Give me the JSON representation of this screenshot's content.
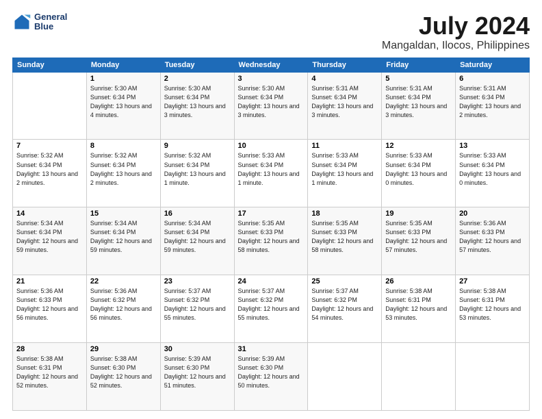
{
  "logo": {
    "line1": "General",
    "line2": "Blue"
  },
  "title": "July 2024",
  "subtitle": "Mangaldan, Ilocos, Philippines",
  "headers": [
    "Sunday",
    "Monday",
    "Tuesday",
    "Wednesday",
    "Thursday",
    "Friday",
    "Saturday"
  ],
  "weeks": [
    [
      {
        "day": "",
        "sunrise": "",
        "sunset": "",
        "daylight": ""
      },
      {
        "day": "1",
        "sunrise": "Sunrise: 5:30 AM",
        "sunset": "Sunset: 6:34 PM",
        "daylight": "Daylight: 13 hours and 4 minutes."
      },
      {
        "day": "2",
        "sunrise": "Sunrise: 5:30 AM",
        "sunset": "Sunset: 6:34 PM",
        "daylight": "Daylight: 13 hours and 3 minutes."
      },
      {
        "day": "3",
        "sunrise": "Sunrise: 5:30 AM",
        "sunset": "Sunset: 6:34 PM",
        "daylight": "Daylight: 13 hours and 3 minutes."
      },
      {
        "day": "4",
        "sunrise": "Sunrise: 5:31 AM",
        "sunset": "Sunset: 6:34 PM",
        "daylight": "Daylight: 13 hours and 3 minutes."
      },
      {
        "day": "5",
        "sunrise": "Sunrise: 5:31 AM",
        "sunset": "Sunset: 6:34 PM",
        "daylight": "Daylight: 13 hours and 3 minutes."
      },
      {
        "day": "6",
        "sunrise": "Sunrise: 5:31 AM",
        "sunset": "Sunset: 6:34 PM",
        "daylight": "Daylight: 13 hours and 2 minutes."
      }
    ],
    [
      {
        "day": "7",
        "sunrise": "Sunrise: 5:32 AM",
        "sunset": "Sunset: 6:34 PM",
        "daylight": "Daylight: 13 hours and 2 minutes."
      },
      {
        "day": "8",
        "sunrise": "Sunrise: 5:32 AM",
        "sunset": "Sunset: 6:34 PM",
        "daylight": "Daylight: 13 hours and 2 minutes."
      },
      {
        "day": "9",
        "sunrise": "Sunrise: 5:32 AM",
        "sunset": "Sunset: 6:34 PM",
        "daylight": "Daylight: 13 hours and 1 minute."
      },
      {
        "day": "10",
        "sunrise": "Sunrise: 5:33 AM",
        "sunset": "Sunset: 6:34 PM",
        "daylight": "Daylight: 13 hours and 1 minute."
      },
      {
        "day": "11",
        "sunrise": "Sunrise: 5:33 AM",
        "sunset": "Sunset: 6:34 PM",
        "daylight": "Daylight: 13 hours and 1 minute."
      },
      {
        "day": "12",
        "sunrise": "Sunrise: 5:33 AM",
        "sunset": "Sunset: 6:34 PM",
        "daylight": "Daylight: 13 hours and 0 minutes."
      },
      {
        "day": "13",
        "sunrise": "Sunrise: 5:33 AM",
        "sunset": "Sunset: 6:34 PM",
        "daylight": "Daylight: 13 hours and 0 minutes."
      }
    ],
    [
      {
        "day": "14",
        "sunrise": "Sunrise: 5:34 AM",
        "sunset": "Sunset: 6:34 PM",
        "daylight": "Daylight: 12 hours and 59 minutes."
      },
      {
        "day": "15",
        "sunrise": "Sunrise: 5:34 AM",
        "sunset": "Sunset: 6:34 PM",
        "daylight": "Daylight: 12 hours and 59 minutes."
      },
      {
        "day": "16",
        "sunrise": "Sunrise: 5:34 AM",
        "sunset": "Sunset: 6:34 PM",
        "daylight": "Daylight: 12 hours and 59 minutes."
      },
      {
        "day": "17",
        "sunrise": "Sunrise: 5:35 AM",
        "sunset": "Sunset: 6:33 PM",
        "daylight": "Daylight: 12 hours and 58 minutes."
      },
      {
        "day": "18",
        "sunrise": "Sunrise: 5:35 AM",
        "sunset": "Sunset: 6:33 PM",
        "daylight": "Daylight: 12 hours and 58 minutes."
      },
      {
        "day": "19",
        "sunrise": "Sunrise: 5:35 AM",
        "sunset": "Sunset: 6:33 PM",
        "daylight": "Daylight: 12 hours and 57 minutes."
      },
      {
        "day": "20",
        "sunrise": "Sunrise: 5:36 AM",
        "sunset": "Sunset: 6:33 PM",
        "daylight": "Daylight: 12 hours and 57 minutes."
      }
    ],
    [
      {
        "day": "21",
        "sunrise": "Sunrise: 5:36 AM",
        "sunset": "Sunset: 6:33 PM",
        "daylight": "Daylight: 12 hours and 56 minutes."
      },
      {
        "day": "22",
        "sunrise": "Sunrise: 5:36 AM",
        "sunset": "Sunset: 6:32 PM",
        "daylight": "Daylight: 12 hours and 56 minutes."
      },
      {
        "day": "23",
        "sunrise": "Sunrise: 5:37 AM",
        "sunset": "Sunset: 6:32 PM",
        "daylight": "Daylight: 12 hours and 55 minutes."
      },
      {
        "day": "24",
        "sunrise": "Sunrise: 5:37 AM",
        "sunset": "Sunset: 6:32 PM",
        "daylight": "Daylight: 12 hours and 55 minutes."
      },
      {
        "day": "25",
        "sunrise": "Sunrise: 5:37 AM",
        "sunset": "Sunset: 6:32 PM",
        "daylight": "Daylight: 12 hours and 54 minutes."
      },
      {
        "day": "26",
        "sunrise": "Sunrise: 5:38 AM",
        "sunset": "Sunset: 6:31 PM",
        "daylight": "Daylight: 12 hours and 53 minutes."
      },
      {
        "day": "27",
        "sunrise": "Sunrise: 5:38 AM",
        "sunset": "Sunset: 6:31 PM",
        "daylight": "Daylight: 12 hours and 53 minutes."
      }
    ],
    [
      {
        "day": "28",
        "sunrise": "Sunrise: 5:38 AM",
        "sunset": "Sunset: 6:31 PM",
        "daylight": "Daylight: 12 hours and 52 minutes."
      },
      {
        "day": "29",
        "sunrise": "Sunrise: 5:38 AM",
        "sunset": "Sunset: 6:30 PM",
        "daylight": "Daylight: 12 hours and 52 minutes."
      },
      {
        "day": "30",
        "sunrise": "Sunrise: 5:39 AM",
        "sunset": "Sunset: 6:30 PM",
        "daylight": "Daylight: 12 hours and 51 minutes."
      },
      {
        "day": "31",
        "sunrise": "Sunrise: 5:39 AM",
        "sunset": "Sunset: 6:30 PM",
        "daylight": "Daylight: 12 hours and 50 minutes."
      },
      {
        "day": "",
        "sunrise": "",
        "sunset": "",
        "daylight": ""
      },
      {
        "day": "",
        "sunrise": "",
        "sunset": "",
        "daylight": ""
      },
      {
        "day": "",
        "sunrise": "",
        "sunset": "",
        "daylight": ""
      }
    ]
  ]
}
